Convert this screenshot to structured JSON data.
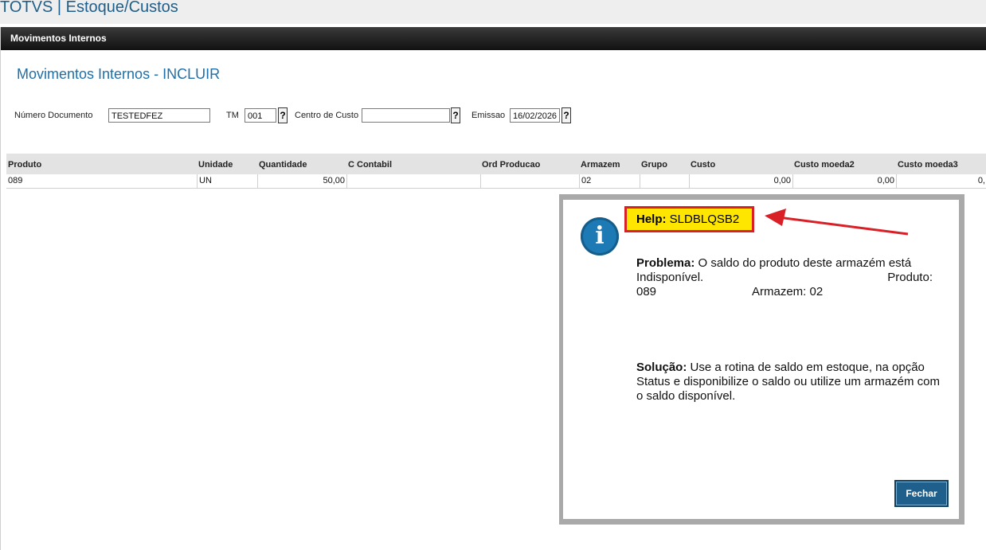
{
  "app": {
    "title": "TOTVS | Estoque/Custos"
  },
  "window": {
    "title": "Movimentos Internos"
  },
  "page_title": "Movimentos Internos - INCLUIR",
  "form": {
    "numero_documento": {
      "label": "Número Documento",
      "value": "TESTEDFEZ"
    },
    "tm": {
      "label": "TM",
      "value": "001"
    },
    "centro_custo": {
      "label": "Centro de Custo",
      "value": ""
    },
    "emissao": {
      "label": "Emissao",
      "value": "16/02/2026"
    },
    "lookup_label": "?"
  },
  "grid": {
    "headers": [
      "Produto",
      "Unidade",
      "Quantidade",
      "C Contabil",
      "Ord Producao",
      "Armazem",
      "Grupo",
      "Custo",
      "Custo moeda2",
      "Custo moeda3"
    ],
    "rows": [
      [
        "089",
        "UN",
        "50,00",
        "",
        "",
        "02",
        "",
        "0,00",
        "0,00",
        "0,"
      ]
    ]
  },
  "dialog": {
    "help_label": "Help:",
    "help_code": "SLDBLQSB2",
    "icon": "info-icon",
    "problem_label": "Problema:",
    "problem_text": "O saldo do produto deste armazém está",
    "problem_line2_left": "Indisponível.",
    "problem_line2_right": "Produto:",
    "problem_line3_left": "089",
    "problem_line3_right": "Armazem: 02",
    "solution_label": "Solução:",
    "solution_text": "Use a rotina de saldo em estoque, na opção Status e disponibilize o saldo ou utilize um armazém com o saldo disponível.",
    "close_label": "Fechar"
  },
  "colors": {
    "accent": "#1f5f8b",
    "highlight": "#ffe600",
    "annotation": "#d92027"
  }
}
